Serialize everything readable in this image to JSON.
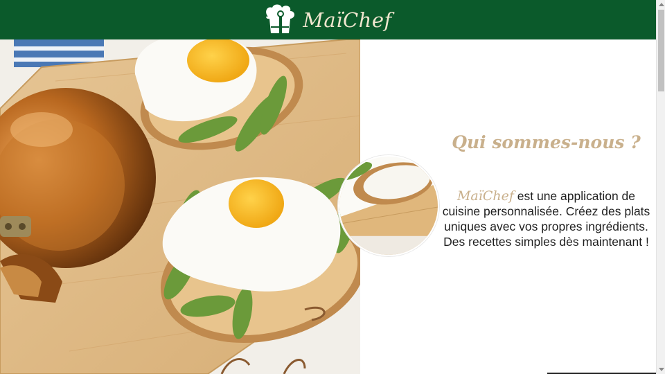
{
  "header": {
    "logo_text": "MaïChef",
    "logo_icon": "chef-hat-icon",
    "background": "#0b5a2b"
  },
  "hero": {
    "image": "eggs-avocado-toast-photo",
    "inset_image": "toast-closeup-photo"
  },
  "about": {
    "title": "Qui sommes-nous ?",
    "brand": "MaïChef",
    "text": " est une application de cuisine personnalisée. Créez des plats uniques avec vos propres ingrédients. Des recettes simples dès maintenant !"
  },
  "colors": {
    "brand_green": "#0b5a2b",
    "accent_beige": "#c9b08c",
    "text_dark": "#1f1f1f"
  }
}
